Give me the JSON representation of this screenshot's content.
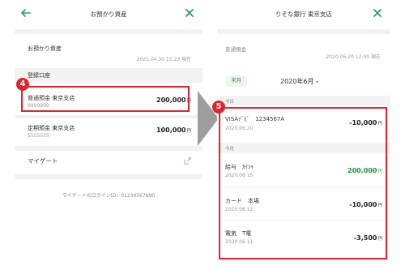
{
  "left_screen": {
    "title": "お預かり資産",
    "section_title": "お預かり資産",
    "timestamp": "2025.04.30 15:23 現在",
    "registered_label": "登録口座",
    "accounts": [
      {
        "name": "普通預金 東京支店",
        "number": "9999999",
        "amount": "200,000",
        "currency": "円"
      },
      {
        "name": "定期預金 東京支店",
        "number": "5555555",
        "amount": "100,000",
        "currency": "円"
      }
    ],
    "mygate_label": "マイゲート",
    "login_id_text": "マイゲートのログインID：01234567890",
    "badge": "4"
  },
  "right_screen": {
    "title": "りそな銀行 東京支店",
    "account_type": "普通預金",
    "timestamp": "2020.06.20 12:00 現在",
    "prev_month": "前月",
    "month": "2020年6月",
    "today_label": "今日",
    "this_month_label": "今月",
    "badge": "5",
    "transactions_today": [
      {
        "desc": "VISAﾃﾞﾋﾞ　1234567A",
        "date": "2020.06.20",
        "amount": "-10,000",
        "currency": "円"
      }
    ],
    "transactions_month": [
      {
        "desc": "給与　ｶｲｼｬ",
        "date": "2020.06.15",
        "amount": "200,000",
        "currency": "円",
        "positive": true
      },
      {
        "desc": "カード　本場",
        "date": "2020.06.12",
        "amount": "-10,000",
        "currency": "円"
      },
      {
        "desc": "電気　T電",
        "date": "2020.06.11",
        "amount": "-3,500",
        "currency": "円"
      }
    ]
  },
  "colors": {
    "accent_green": "#2e9b5b",
    "highlight_red": "#e0242d",
    "arrow_gray": "#9e9e9e"
  }
}
